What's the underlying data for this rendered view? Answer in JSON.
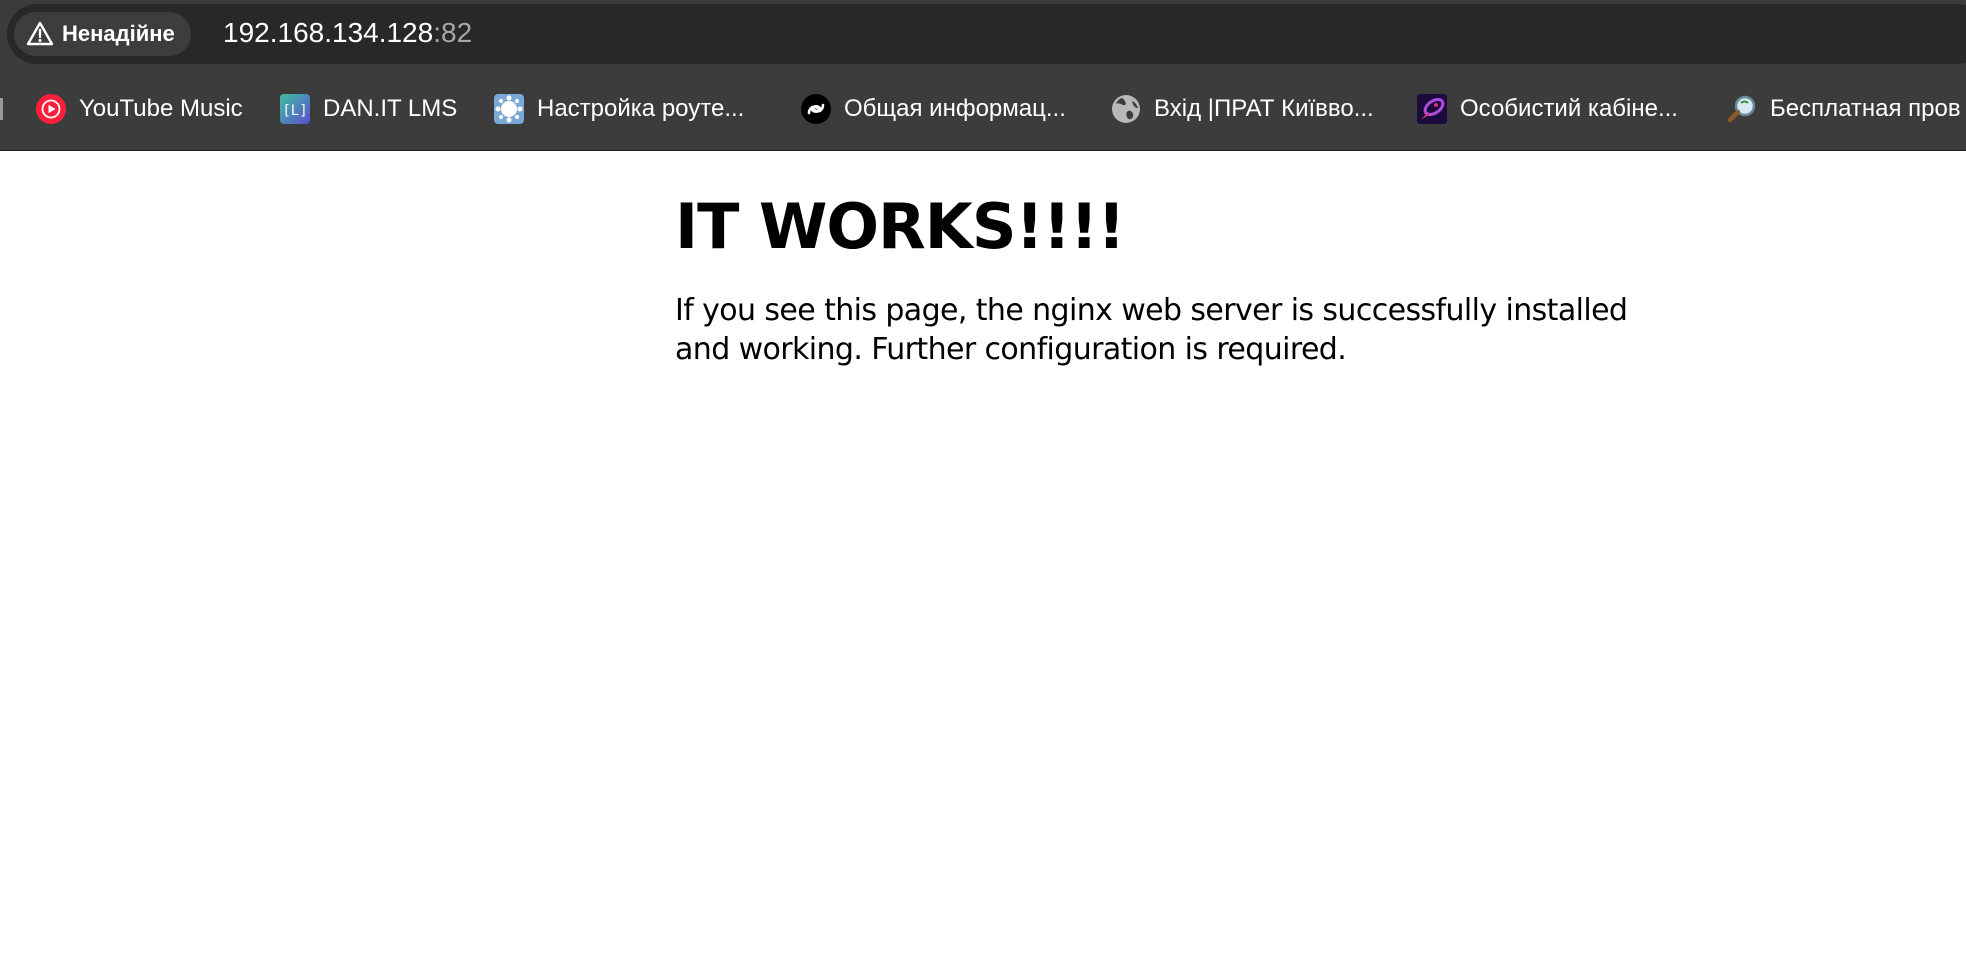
{
  "browser": {
    "security_label": "Ненадійне",
    "url_host": "192.168.134.128",
    "url_port": ":82"
  },
  "bookmarks": [
    {
      "label": "YouTube Music",
      "icon": "youtube-music-icon",
      "color": "#ff1f3c"
    },
    {
      "label": "DAN.IT LMS",
      "icon": "lms-icon",
      "color": "#4a6cc8"
    },
    {
      "label": "Настройка роуте...",
      "icon": "router-icon",
      "color": "#7aa8d8"
    },
    {
      "label": "Общая информац...",
      "icon": "swirl-icon",
      "color": "#000000"
    },
    {
      "label": "Вхід |ПРАТ Київво...",
      "icon": "globe-icon",
      "color": "#b8b8b8"
    },
    {
      "label": "Особистий кабіне...",
      "icon": "rocket-icon",
      "color": "#8a2be2"
    },
    {
      "label": "Бесплатная пров",
      "icon": "magnifier-icon",
      "color": "#3a8f3a"
    }
  ],
  "page": {
    "title": "IT WORKS!!!!",
    "text": "If you see this page, the nginx web server is successfully installed and working. Further configuration is required."
  }
}
